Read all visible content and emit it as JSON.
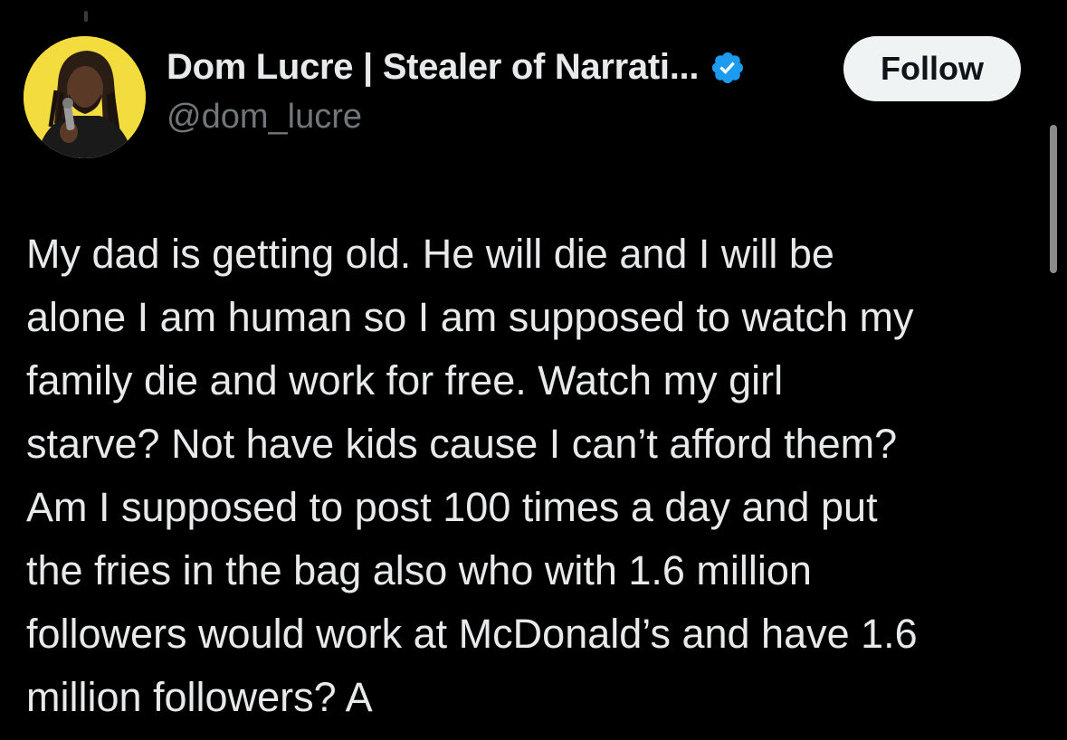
{
  "author": {
    "display_name": "Dom Lucre | Stealer of Narrati...",
    "handle": "@dom_lucre",
    "avatar_icon": "avatar-photo",
    "verified_icon": "verified-badge-icon",
    "verified_color": "#1d9bf0",
    "avatar_bg": "#f3dc3e"
  },
  "follow_button": {
    "label": "Follow"
  },
  "tweet": {
    "lines": [
      "My dad is getting old. He will die and I will be",
      "alone I am human so I am supposed to watch my",
      "family die and work for free. Watch my girl",
      "starve? Not have kids cause I can’t afford them?",
      "Am I supposed to post 100 times a day and put",
      "the fries in the bag also who with 1.6 million",
      "followers would work at McDonald’s and have 1.6",
      "million followers? A"
    ]
  },
  "colors": {
    "background": "#000000",
    "text_primary": "#e7e9ea",
    "text_secondary": "#71767b",
    "button_bg": "#eff3f4",
    "button_text": "#0f1419"
  }
}
